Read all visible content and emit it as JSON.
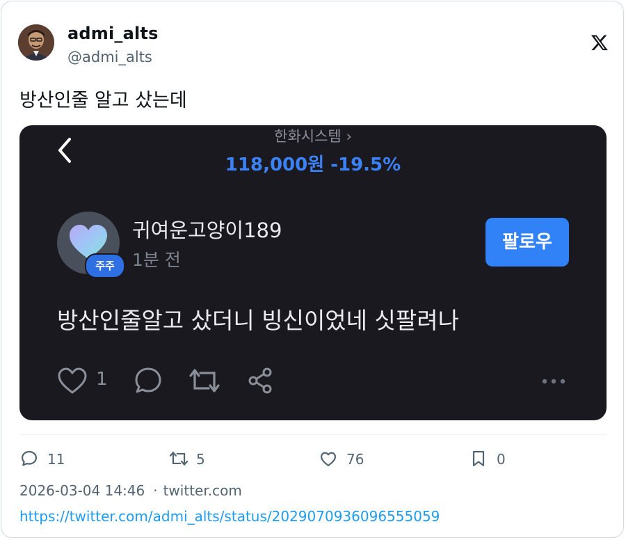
{
  "author": {
    "display_name": "admi_alts",
    "handle": "@admi_alts"
  },
  "tweet": {
    "text": "방산인줄 알고 샀는데"
  },
  "media": {
    "company": "한화시스템",
    "company_chevron": "›",
    "price_line": "118,000원 -19.5%",
    "post": {
      "username": "귀여운고양이189",
      "time": "1분 전",
      "badge": "주주",
      "follow_label": "팔로우",
      "body": "방산인줄알고 샀더니 빙신이었네 싯팔려나",
      "like_count": "1"
    }
  },
  "actions": {
    "replies": "11",
    "retweets": "5",
    "likes": "76",
    "bookmarks": "0"
  },
  "meta": {
    "datetime": "2026-03-04 14:46",
    "separator": "·",
    "source": "twitter.com",
    "url": "https://twitter.com/admi_alts/status/2029070936096555059"
  },
  "colors": {
    "accent": "#1d9bf0",
    "media_background": "#1a191f",
    "price_blue": "#3b82f6",
    "follow_button": "#3182f6"
  }
}
